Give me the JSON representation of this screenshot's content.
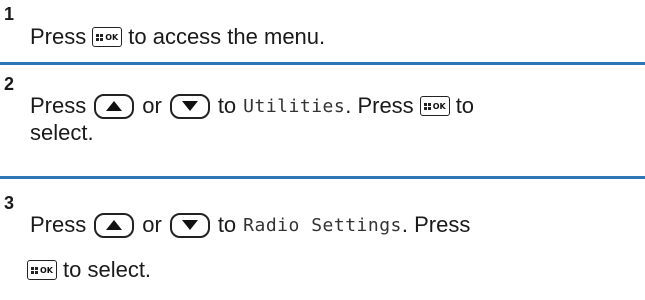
{
  "steps": [
    {
      "number": "1",
      "parts": {
        "press": "Press",
        "after": "to access the menu."
      }
    },
    {
      "number": "2",
      "parts": {
        "press": "Press",
        "or": "or",
        "to": "to",
        "target": "Utilities",
        "period_press": ". Press",
        "to2": "to",
        "select": "select."
      }
    },
    {
      "number": "3",
      "parts": {
        "press": "Press",
        "or": "or",
        "to": "to",
        "target": "Radio Settings",
        "period_press": ". Press",
        "select": "to select."
      }
    }
  ],
  "keys": {
    "ok_label": "OK",
    "ok_icon": "menu-ok-key-icon",
    "up_icon": "up-arrow-key-icon",
    "down_icon": "down-arrow-key-icon"
  },
  "colors": {
    "divider": "#2f76b6",
    "text": "#1a1a1a"
  }
}
